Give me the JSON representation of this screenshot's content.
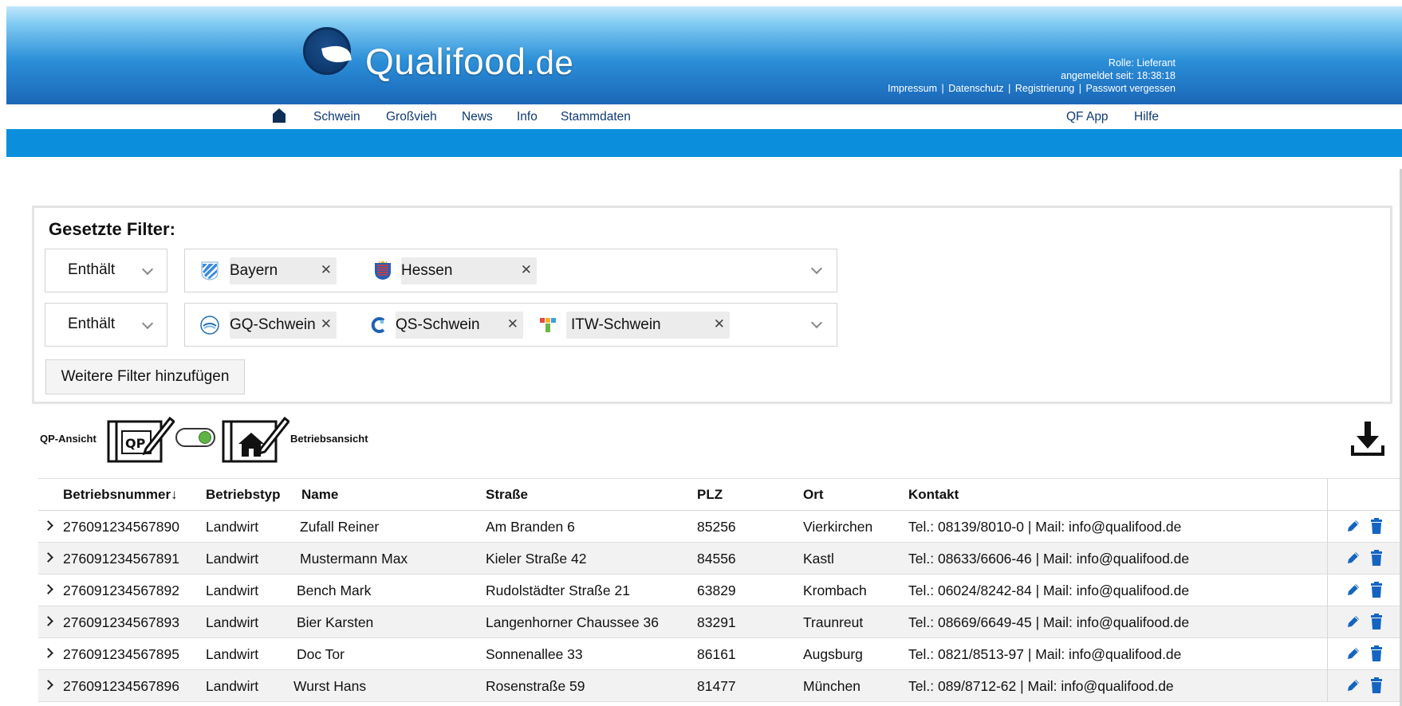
{
  "header": {
    "logo_text": "Qualifood",
    "logo_tld": ".de",
    "role_label": "Rolle: Lieferant",
    "logged_in_since": "angemeldet seit: 18:38:18",
    "links": [
      "Impressum",
      "Datenschutz",
      "Registrierung",
      "Passwort vergessen"
    ]
  },
  "nav": {
    "home_icon": "home-icon",
    "left_items": [
      "Schwein",
      "Großvieh",
      "News",
      "Info",
      "Stammdaten"
    ],
    "right_items": [
      "QF App",
      "Hilfe"
    ]
  },
  "filters": {
    "title": "Gesetzte Filter:",
    "rows": [
      {
        "operator": "Enthält",
        "tags": [
          {
            "label": "Bayern",
            "icon": "bavaria-flag-icon"
          },
          {
            "label": "Hessen",
            "icon": "hesse-coat-of-arms-icon"
          }
        ]
      },
      {
        "operator": "Enthält",
        "tags": [
          {
            "label": "GQ-Schwein",
            "icon": "gq-seal-icon"
          },
          {
            "label": "QS-Schwein",
            "icon": "qs-logo-icon"
          },
          {
            "label": "ITW-Schwein",
            "icon": "itw-logo-icon"
          }
        ]
      }
    ],
    "add_button": "Weitere Filter hinzufügen"
  },
  "view_toggle": {
    "left_label": "QP-Ansicht",
    "left_icon_text": "QP",
    "right_label": "Betriebsansicht",
    "state": "Betriebsansicht"
  },
  "download_icon": "download-icon",
  "table": {
    "columns": [
      "Betriebsnummer",
      "Betriebstyp",
      "Name",
      "Straße",
      "PLZ",
      "Ort",
      "Kontakt"
    ],
    "sort_indicator": "↓",
    "rows": [
      {
        "nr": "276091234567890",
        "typ": "Landwirt",
        "name": "Zufall Reiner",
        "strasse": "Am Branden 6",
        "plz": "85256",
        "ort": "Vierkirchen",
        "kontakt": "Tel.: 08139/8010-0 | Mail: info@qualifood.de"
      },
      {
        "nr": "276091234567891",
        "typ": "Landwirt",
        "name": "Mustermann Max",
        "strasse": "Kieler Straße 42",
        "plz": "84556",
        "ort": "Kastl",
        "kontakt": "Tel.: 08633/6606-46 | Mail: info@qualifood.de"
      },
      {
        "nr": "276091234567892",
        "typ": "Landwirt",
        "name": "Bench Mark",
        "strasse": "Rudolstädter Straße 21",
        "plz": "63829",
        "ort": "Krombach",
        "kontakt": "Tel.: 06024/8242-84 | Mail: info@qualifood.de"
      },
      {
        "nr": "276091234567893",
        "typ": "Landwirt",
        "name": "Bier Karsten",
        "strasse": "Langenhorner Chaussee 36",
        "plz": "83291",
        "ort": "Traunreut",
        "kontakt": "Tel.: 08669/6649-45 | Mail: info@qualifood.de"
      },
      {
        "nr": "276091234567895",
        "typ": "Landwirt",
        "name": "Doc Tor",
        "strasse": "Sonnenallee 33",
        "plz": "86161",
        "ort": "Augsburg",
        "kontakt": "Tel.: 0821/8513-97 | Mail: info@qualifood.de"
      },
      {
        "nr": "276091234567896",
        "typ": "Landwirt",
        "name": "Wurst Hans",
        "strasse": "Rosenstraße 59",
        "plz": "81477",
        "ort": "München",
        "kontakt": "Tel.: 089/8712-62 | Mail: info@qualifood.de"
      }
    ],
    "row_actions": [
      "edit-icon",
      "trash-icon"
    ]
  },
  "colors": {
    "header_dark": "#1a67b8",
    "header_light": "#bfe6fb",
    "blue_bar": "#0b8fdd",
    "nav_text": "#0f3a70",
    "toggle_on": "#5fb244"
  }
}
